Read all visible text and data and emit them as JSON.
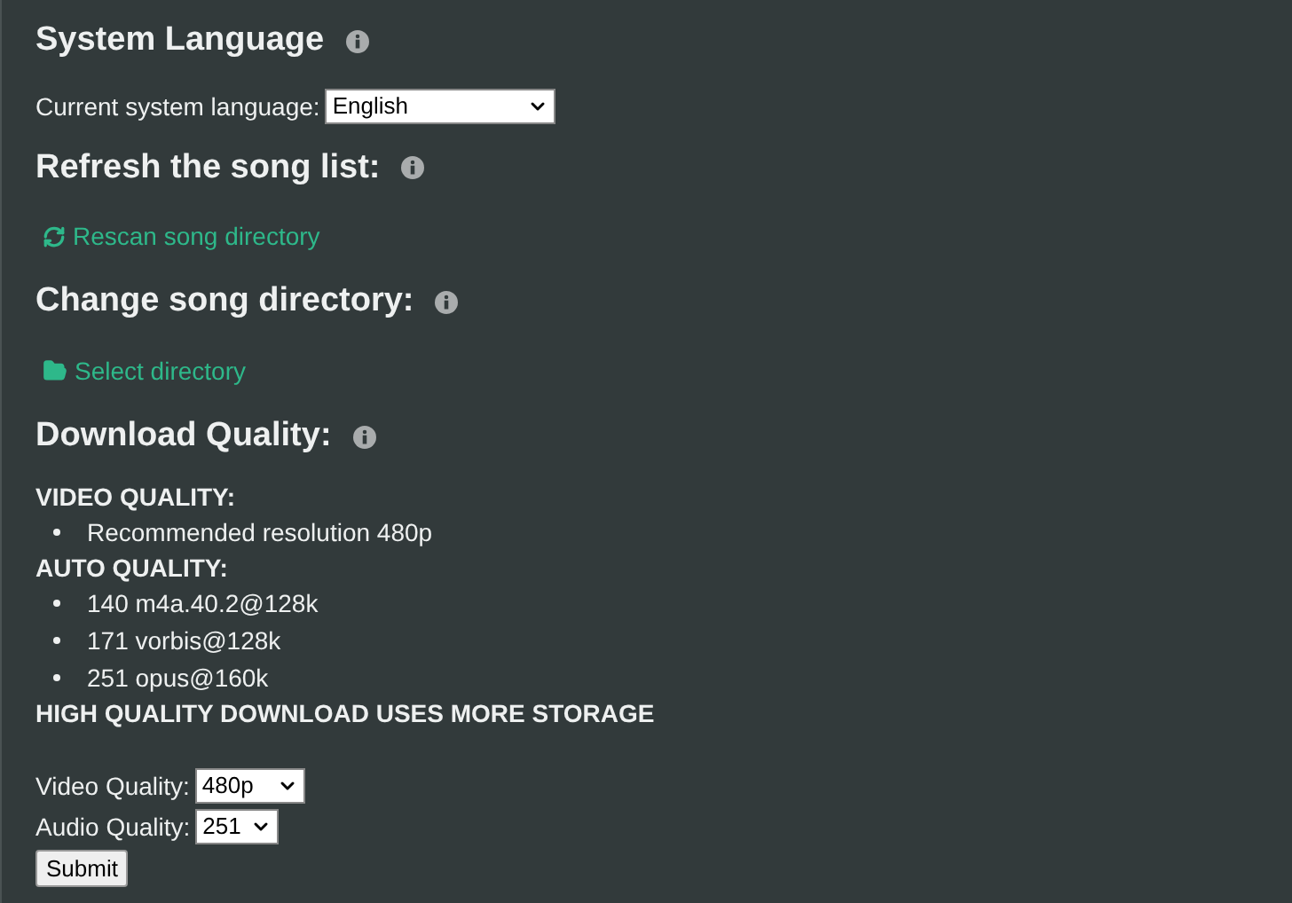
{
  "sections": [
    {
      "kind": "language",
      "title": "System Language",
      "label": "Current system language:",
      "value": "English"
    },
    {
      "kind": "action",
      "title": "Refresh the song list:",
      "action": {
        "kind": "rescan",
        "label": "Rescan song directory"
      }
    },
    {
      "kind": "action",
      "title": "Change song directory:",
      "action": {
        "kind": "select",
        "label": "Select directory"
      }
    },
    {
      "kind": "quality",
      "title": "Download Quality:"
    }
  ],
  "quality_info": [
    {
      "heading": "VIDEO QUALITY:",
      "items": [
        "Recommended resolution 480p"
      ]
    },
    {
      "heading": "AUTO QUALITY:",
      "items": [
        "140 m4a.40.2@128k",
        "171 vorbis@128k",
        "251 opus@160k"
      ]
    }
  ],
  "storage_note": "HIGH QUALITY DOWNLOAD USES MORE STORAGE",
  "form": {
    "fields": [
      {
        "label": "Video Quality:",
        "value": "480p"
      },
      {
        "label": "Audio Quality:",
        "value": "251"
      }
    ],
    "submit": "Submit"
  }
}
